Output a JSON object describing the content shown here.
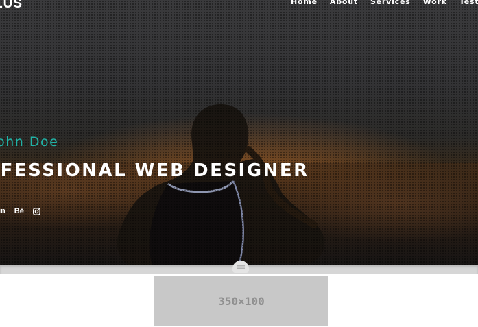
{
  "brand": {
    "text": "LUS"
  },
  "nav": {
    "items": [
      {
        "label": "Home"
      },
      {
        "label": "About"
      },
      {
        "label": "Services"
      },
      {
        "label": "Work"
      },
      {
        "label": "Testimonials"
      }
    ]
  },
  "hero": {
    "name": "John Doe",
    "title": "OFESSIONAL WEB DESIGNER",
    "social": [
      {
        "label": "in",
        "icon": "linkedin-icon"
      },
      {
        "label": "Bē",
        "icon": "behance-icon"
      },
      {
        "label": "",
        "icon": "instagram-icon"
      }
    ]
  },
  "ad": {
    "text": "350×100"
  },
  "colors": {
    "accent": "#20b2a6",
    "nav_text": "#ffffff",
    "divider": "#d6d6d6",
    "placeholder_bg": "#c8c8c8",
    "placeholder_text": "#8f8f8f"
  }
}
